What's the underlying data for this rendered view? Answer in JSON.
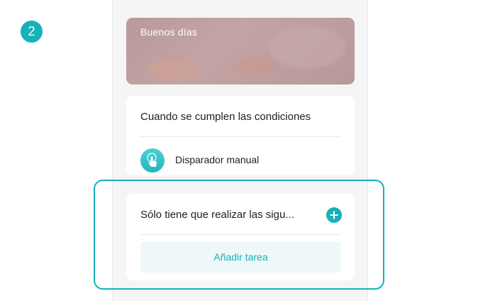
{
  "step": {
    "number": "2",
    "color": "#16b1b9"
  },
  "banner": {
    "title": "Buenos días"
  },
  "conditions": {
    "heading": "Cuando se cumplen las condiciones",
    "trigger_label": "Disparador manual",
    "trigger_icon": "tap-hand-icon"
  },
  "actions": {
    "heading": "Sólo tiene que realizar las sigu...",
    "add_icon": "plus-circle-icon",
    "add_task_label": "Añadir tarea"
  },
  "colors": {
    "accent": "#16b1b9",
    "banner": "#bf9f9f",
    "background": "#f5f5f5"
  }
}
